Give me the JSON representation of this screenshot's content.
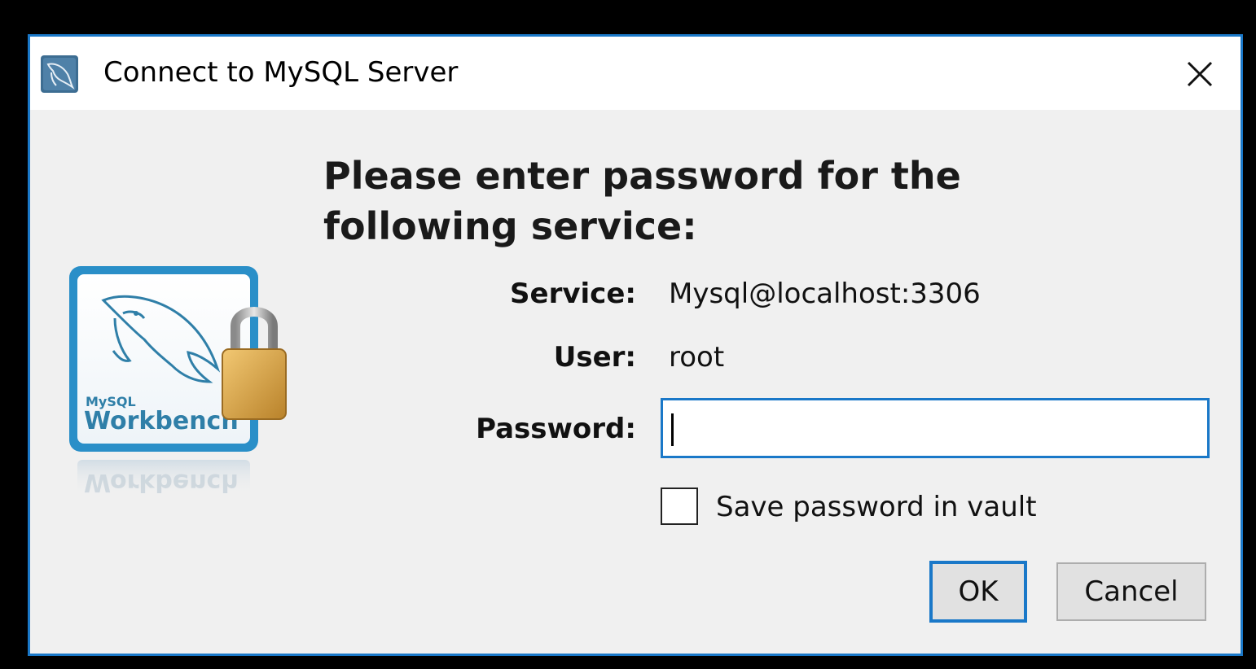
{
  "window": {
    "title": "Connect to MySQL Server",
    "app_icon": "mysql-workbench-icon",
    "close_icon": "close-icon"
  },
  "logo": {
    "brand_small": "MySQL",
    "brand_large": "Workbench",
    "reflection": "Workbench",
    "lock_icon": "padlock-icon"
  },
  "heading": {
    "line1": "Please enter password for the",
    "line2": "following service:"
  },
  "fields": {
    "service_label": "Service:",
    "service_value": "Mysql@localhost:3306",
    "user_label": "User:",
    "user_value": "root",
    "password_label": "Password:",
    "password_value": ""
  },
  "save_password": {
    "label": "Save password in vault",
    "checked": false
  },
  "buttons": {
    "ok": "OK",
    "cancel": "Cancel"
  },
  "colors": {
    "accent": "#1a78c8",
    "dialog_bg": "#f0f0f0",
    "titlebar_bg": "#ffffff",
    "logo_frame": "#2a8fc8",
    "lock_body": "#d9a441"
  }
}
